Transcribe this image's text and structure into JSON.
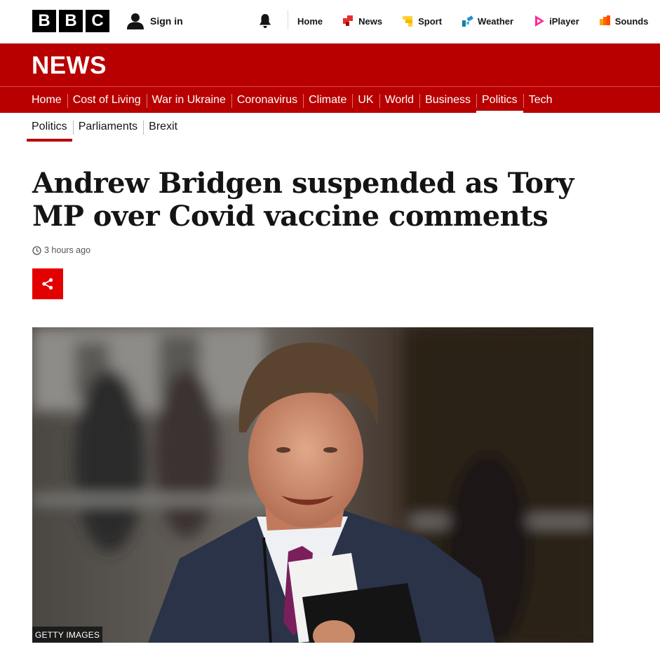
{
  "brand": {
    "logo_letters": [
      "B",
      "B",
      "C"
    ]
  },
  "account": {
    "signin_label": "Sign in"
  },
  "top_nav": [
    {
      "label": "Home",
      "icon": "none"
    },
    {
      "label": "News",
      "icon": "news-icon",
      "color": "#e52d2d"
    },
    {
      "label": "Sport",
      "icon": "sport-icon",
      "color": "#ffd230"
    },
    {
      "label": "Weather",
      "icon": "weather-icon",
      "color": "#2a8bd8"
    },
    {
      "label": "iPlayer",
      "icon": "iplayer-icon",
      "color": "#ff2a96"
    },
    {
      "label": "Sounds",
      "icon": "sounds-icon",
      "color": "#ff6600"
    }
  ],
  "section": {
    "title": "NEWS"
  },
  "main_nav": [
    "Home",
    "Cost of Living",
    "War in Ukraine",
    "Coronavirus",
    "Climate",
    "UK",
    "World",
    "Business",
    "Politics",
    "Tech"
  ],
  "main_nav_active": "Politics",
  "sub_nav": [
    "Politics",
    "Parliaments",
    "Brexit"
  ],
  "sub_nav_active": "Politics",
  "article": {
    "headline_line1": "Andrew Bridgen suspended as Tory",
    "headline_line2": "MP over Covid vaccine comments",
    "timestamp": "3 hours ago",
    "image_credit": "GETTY IMAGES"
  },
  "colors": {
    "brand_red": "#b80000",
    "share_red": "#e30000"
  }
}
